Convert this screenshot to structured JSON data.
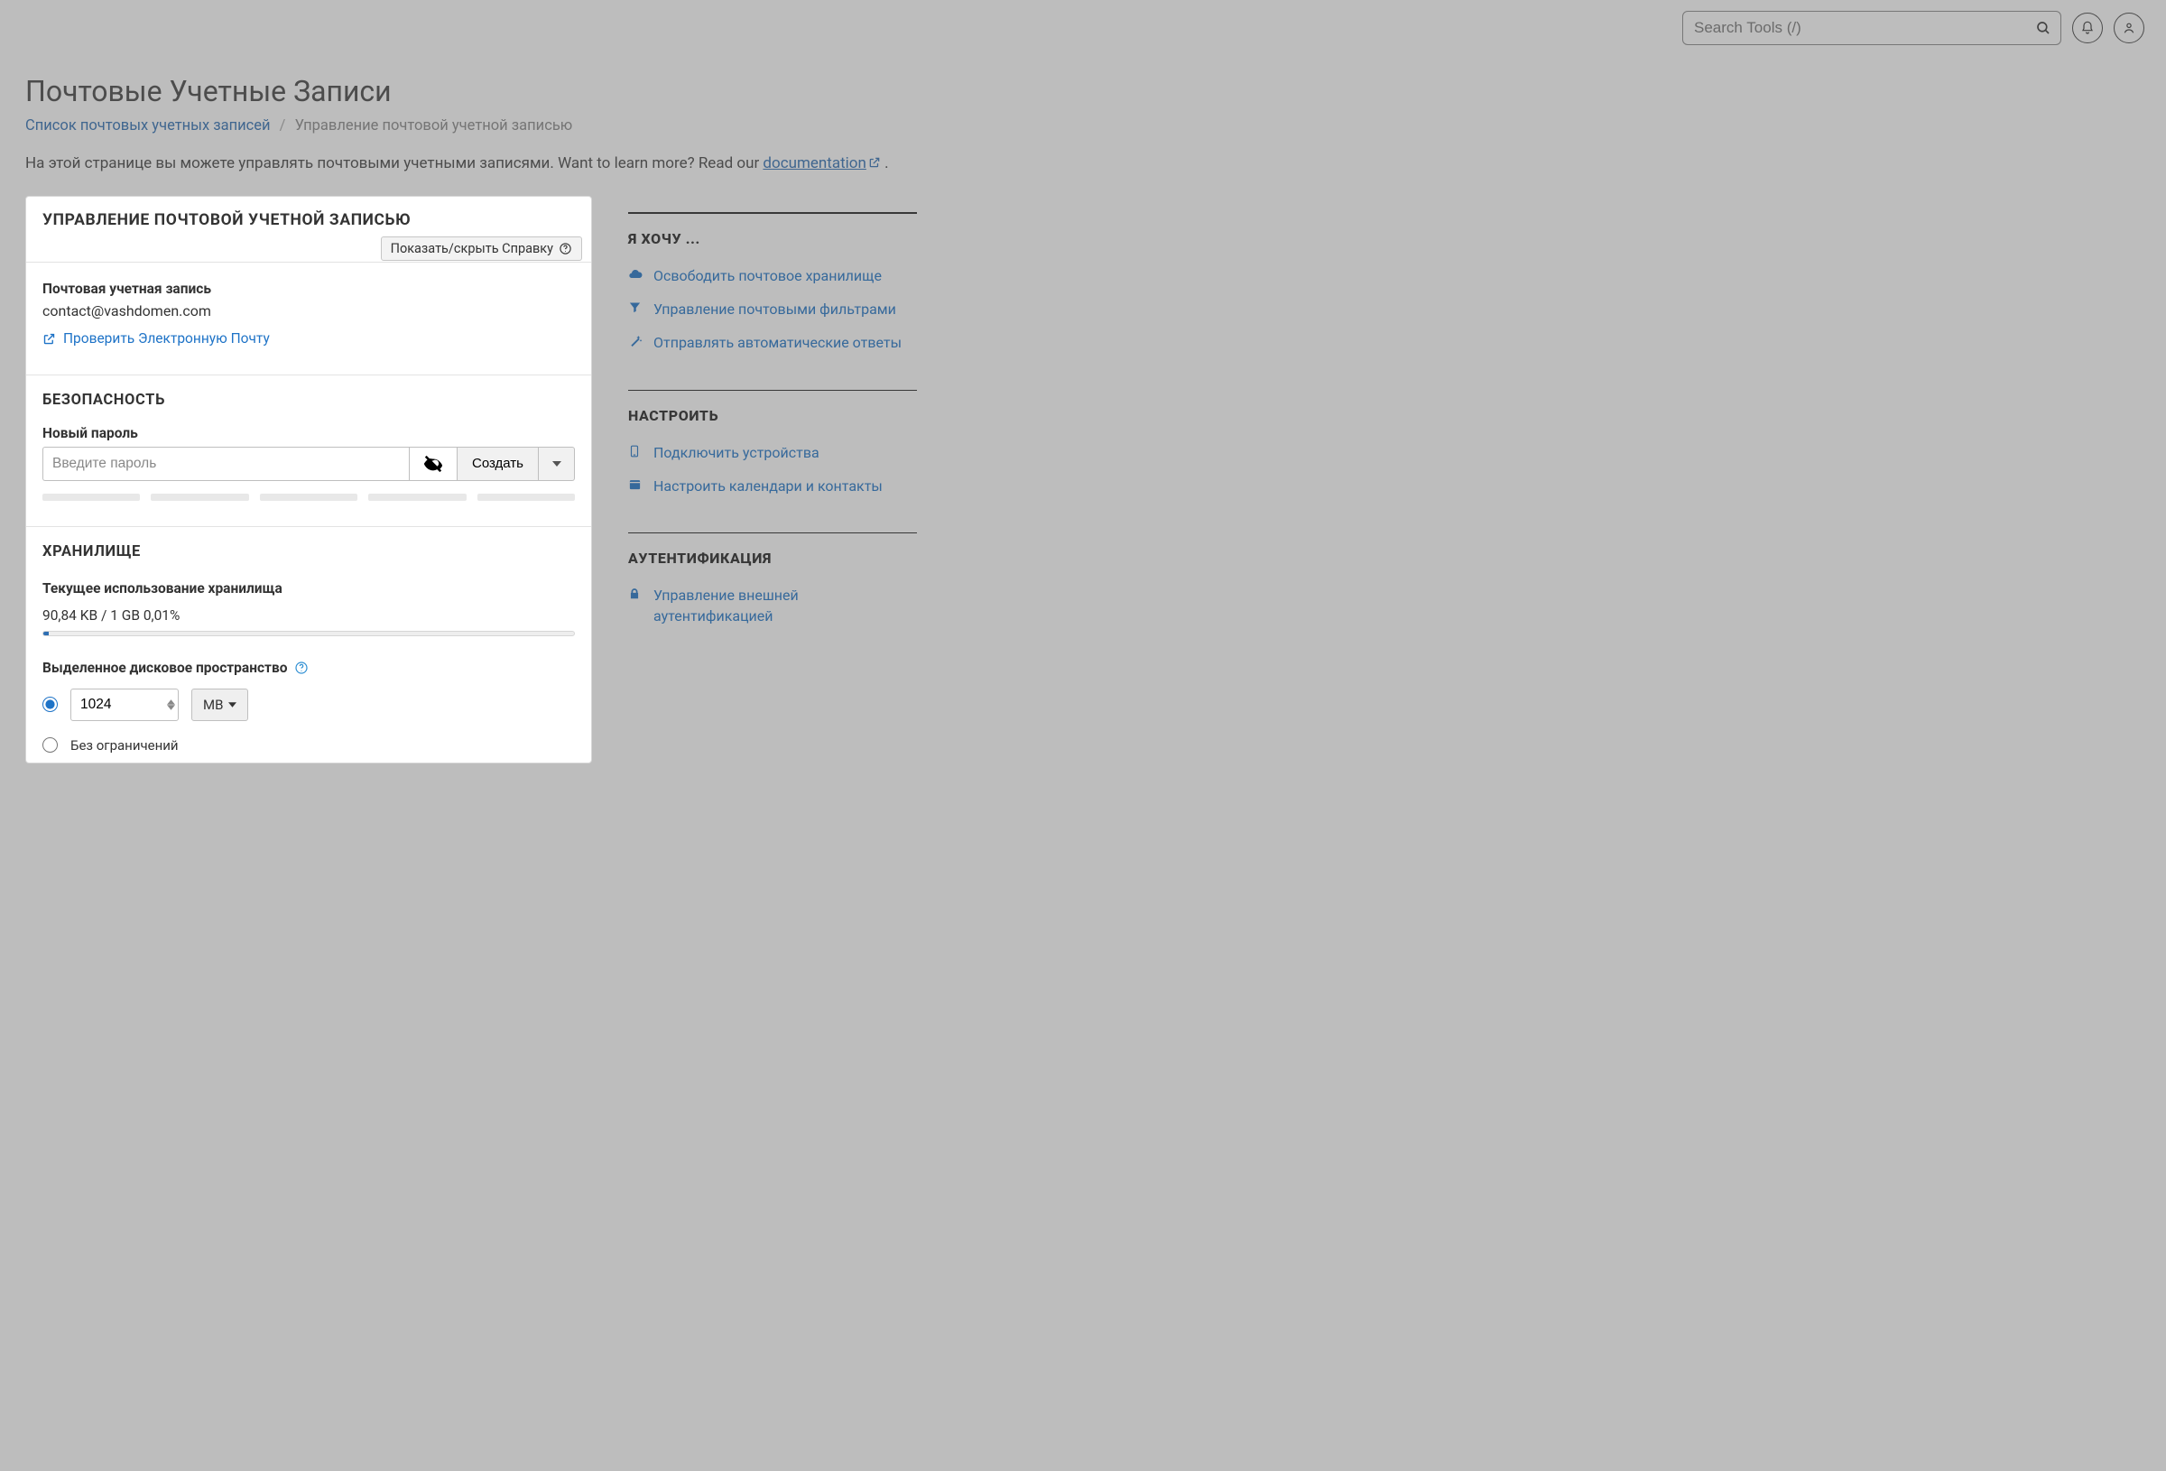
{
  "topbar": {
    "search_placeholder": "Search Tools (/)"
  },
  "page": {
    "title": "Почтовые Учетные Записи",
    "breadcrumb": {
      "link": "Список почтовых учетных записей",
      "current": "Управление почтовой учетной записью"
    },
    "intro_prefix": "На этой странице вы можете управлять почтовыми учетными записями. Want to learn more? Read our ",
    "intro_link": "documentation",
    "intro_suffix": " ."
  },
  "panel": {
    "title": "УПРАВЛЕНИЕ ПОЧТОВОЙ УЧЕТНОЙ ЗАПИСЬЮ",
    "help_toggle": "Показать/скрыть Справку",
    "account_label": "Почтовая учетная запись",
    "account_value": "contact@vashdomen.com",
    "check_mail": "Проверить Электронную Почту",
    "security_title": "БЕЗОПАСНОСТЬ",
    "new_password_label": "Новый пароль",
    "password_placeholder": "Введите пароль",
    "generate": "Создать",
    "storage_title": "ХРАНИЛИЩЕ",
    "usage_label": "Текущее использование хранилища",
    "usage_value": "90,84 KB / 1 GB 0,01%",
    "alloc_label": "Выделенное дисковое пространство",
    "quota_value": "1024",
    "quota_unit": "MB",
    "unlimited_label": "Без ограничений"
  },
  "sidebar": {
    "sections": [
      {
        "title": "Я ХОЧУ ...",
        "links": [
          {
            "icon": "cloud-upload",
            "text": "Освободить почтовое хранилище"
          },
          {
            "icon": "filter",
            "text": "Управление почтовыми фильтрами"
          },
          {
            "icon": "wand",
            "text": "Отправлять автоматические ответы"
          }
        ]
      },
      {
        "title": "НАСТРОИТЬ",
        "links": [
          {
            "icon": "phone",
            "text": "Подключить устройства"
          },
          {
            "icon": "calendar",
            "text": "Настроить календари и контакты"
          }
        ]
      },
      {
        "title": "АУТЕНТИФИКАЦИЯ",
        "links": [
          {
            "icon": "lock",
            "text": "Управление внешней аутентификацией"
          }
        ]
      }
    ]
  }
}
